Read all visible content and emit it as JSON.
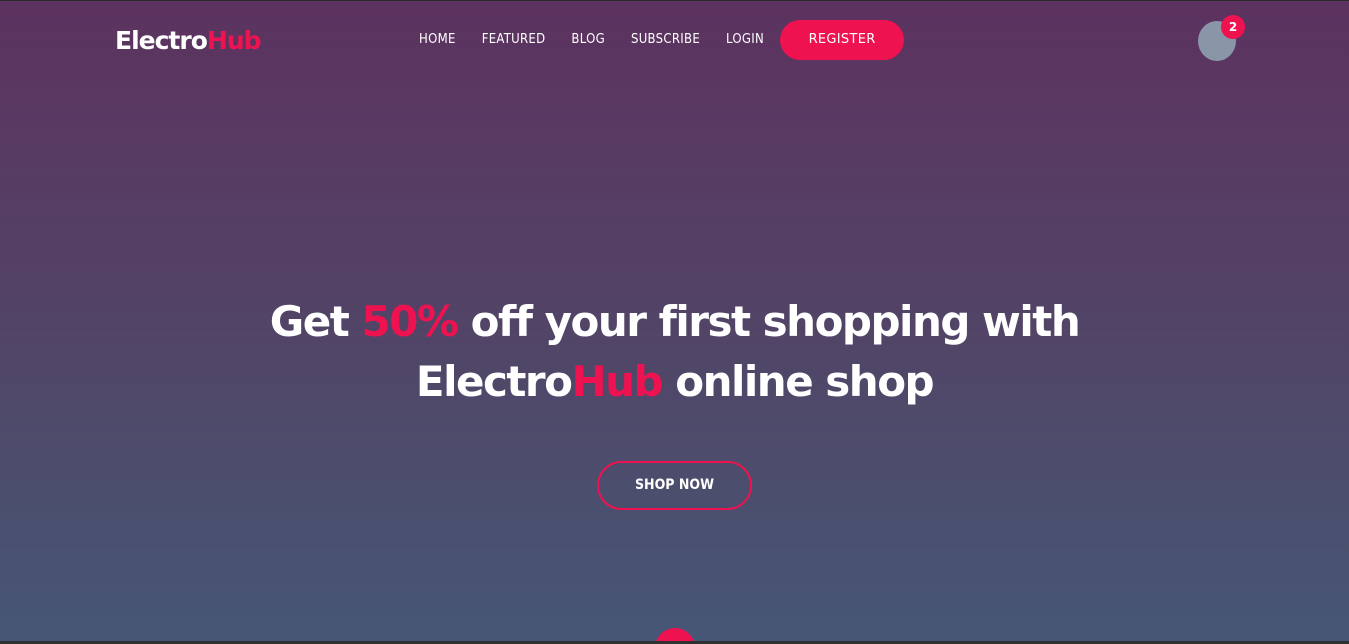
{
  "brand": {
    "name_part1": "Electro",
    "name_part2": "Hub"
  },
  "nav": {
    "items": [
      "HOME",
      "FEATURED",
      "BLOG",
      "SUBSCRIBE",
      "LOGIN"
    ],
    "register_label": "REGISTER"
  },
  "cart": {
    "count": "2",
    "icon": "cart-avatar-icon"
  },
  "hero": {
    "line1_pre": "Get ",
    "line1_accent": "50%",
    "line1_post": " off your first shopping with",
    "line2_brand_part1": "Electro",
    "line2_brand_part2": "Hub",
    "line2_post": " online shop",
    "cta_label": "SHOP NOW"
  },
  "colors": {
    "accent": "#ee1250",
    "gradient_top": "#5c325f",
    "gradient_bottom": "#465775",
    "cart_circle": "#8896a8"
  }
}
